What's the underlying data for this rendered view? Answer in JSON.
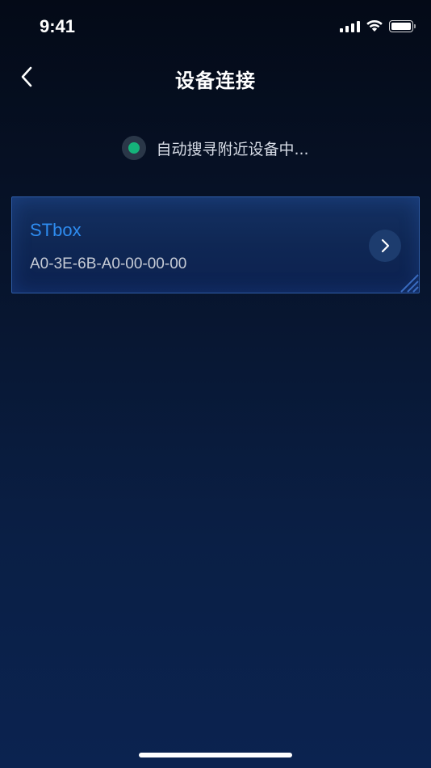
{
  "status_bar": {
    "time": "9:41",
    "icons": [
      "cellular-signal-icon",
      "wifi-icon",
      "battery-icon"
    ]
  },
  "nav": {
    "back_icon": "chevron-left-icon",
    "title": "设备连接"
  },
  "scan": {
    "status_text": "自动搜寻附近设备中...",
    "indicator_color": "#15b37a"
  },
  "devices": [
    {
      "name": "STbox",
      "mac": "A0-3E-6B-A0-00-00-00",
      "action_icon": "chevron-right-icon"
    }
  ],
  "colors": {
    "accent": "#2e8cf0",
    "card_border": "#2f5da8",
    "status_green": "#15b37a"
  }
}
